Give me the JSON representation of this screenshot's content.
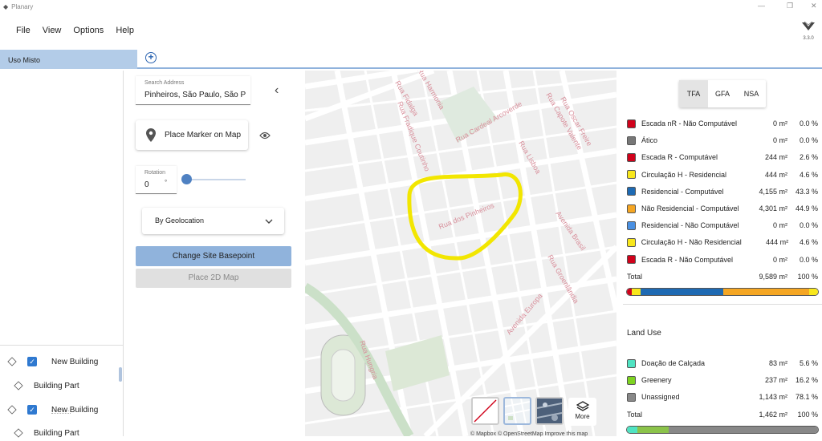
{
  "app": {
    "title": "Planary",
    "version": "3.3.0"
  },
  "menu": [
    "File",
    "View",
    "Options",
    "Help"
  ],
  "tab": {
    "label": "Uso Misto"
  },
  "tree": [
    {
      "label": "New Building",
      "checked": true
    },
    {
      "label": "Building Part"
    },
    {
      "label": "New Building",
      "checked": true
    },
    {
      "label": "Building Part"
    }
  ],
  "address": {
    "label": "Search Address",
    "value": "Pinheiros, São Paulo, São P"
  },
  "marker": {
    "label": "Place Marker on Map"
  },
  "rotation": {
    "label": "Rotation",
    "value": "0",
    "unit": "°",
    "slider_fraction": 0
  },
  "geo": {
    "label": "By Geolocation"
  },
  "buttons": {
    "basepoint": "Change Site Basepoint",
    "place2d": "Place 2D Map"
  },
  "map": {
    "streets": [
      "Rua Harmonia",
      "Rua Fidalga",
      "Rua Fradique Coutinho",
      "Rua Cardeal Arcoverde",
      "Rua Capote Valente",
      "Rua Oscar Freire",
      "Rua Lisboa",
      "Rua dos Pinheiros",
      "Avenida Brasil",
      "Rua Groenlândia",
      "Avenida Europa",
      "Rua Hungria"
    ],
    "more": "More",
    "attribution": "© Mapbox © OpenStreetMap Improve this map",
    "outline_color": "#f2e600"
  },
  "area": {
    "tabs": [
      "TFA",
      "GFA",
      "NSA"
    ],
    "active": "TFA",
    "rows": [
      {
        "name": "Escada nR - Não Computável",
        "area": "0 m²",
        "pct": "0.0 %",
        "color": "#d0021b"
      },
      {
        "name": "Ático",
        "area": "0 m²",
        "pct": "0.0 %",
        "color": "#777777"
      },
      {
        "name": "Escada R - Computável",
        "area": "244 m²",
        "pct": "2.6 %",
        "color": "#d0021b"
      },
      {
        "name": "Circulação H - Residencial",
        "area": "444 m²",
        "pct": "4.6 %",
        "color": "#f8e71c"
      },
      {
        "name": "Residencial - Computável",
        "area": "4,155 m²",
        "pct": "43.3 %",
        "color": "#1e6ab3"
      },
      {
        "name": "Não Residencial - Computável",
        "area": "4,301 m²",
        "pct": "44.9 %",
        "color": "#f5a623"
      },
      {
        "name": "Residencial - Não Computável",
        "area": "0 m²",
        "pct": "0.0 %",
        "color": "#4a90e2"
      },
      {
        "name": "Circulação H - Não Residencial",
        "area": "444 m²",
        "pct": "4.6 %",
        "color": "#f8e71c"
      },
      {
        "name": "Escada R - Não Computável",
        "area": "0 m²",
        "pct": "0.0 %",
        "color": "#d0021b"
      }
    ],
    "total": {
      "label": "Total",
      "area": "9,589 m²",
      "pct": "100 %"
    },
    "bar": [
      {
        "color": "#d0021b",
        "pct": 2.6
      },
      {
        "color": "#f8e71c",
        "pct": 4.6
      },
      {
        "color": "#1e6ab3",
        "pct": 43.3
      },
      {
        "color": "#f5a623",
        "pct": 44.9
      },
      {
        "color": "#f8e71c",
        "pct": 4.6
      }
    ]
  },
  "landuse": {
    "title": "Land Use",
    "rows": [
      {
        "name": "Doação de Calçada",
        "area": "83 m²",
        "pct": "5.6 %",
        "color": "#50e3c2"
      },
      {
        "name": "Greenery",
        "area": "237 m²",
        "pct": "16.2 %",
        "color": "#7ed321"
      },
      {
        "name": "Unassigned",
        "area": "1,143 m²",
        "pct": "78.1 %",
        "color": "#888888"
      }
    ],
    "total": {
      "label": "Total",
      "area": "1,462 m²",
      "pct": "100 %"
    },
    "bar": [
      {
        "color": "#50e3c2",
        "pct": 5.6
      },
      {
        "color": "#8bc34a",
        "pct": 16.2
      },
      {
        "color": "#888888",
        "pct": 78.1
      }
    ]
  }
}
